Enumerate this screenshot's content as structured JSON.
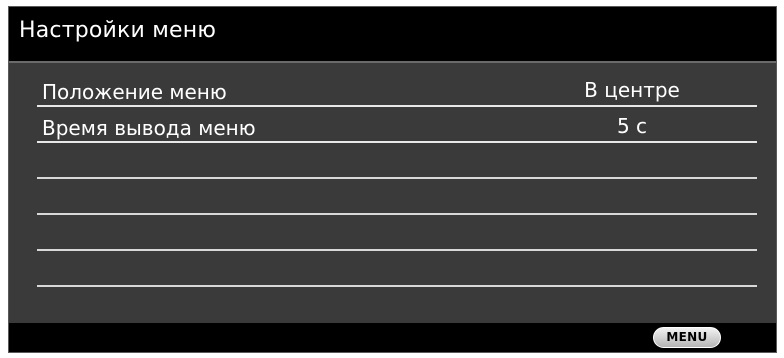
{
  "window": {
    "title": "Настройки меню"
  },
  "menu_items": [
    {
      "label": "Положение меню",
      "value": "В центре"
    },
    {
      "label": "Время вывода меню",
      "value": "5 с"
    }
  ],
  "footer": {
    "menu_button_label": "MENU"
  },
  "colors": {
    "title_bar": "#000000",
    "panel_background": "#3a3a3a",
    "text": "#ffffff",
    "row_line": "#e8e8e8"
  }
}
